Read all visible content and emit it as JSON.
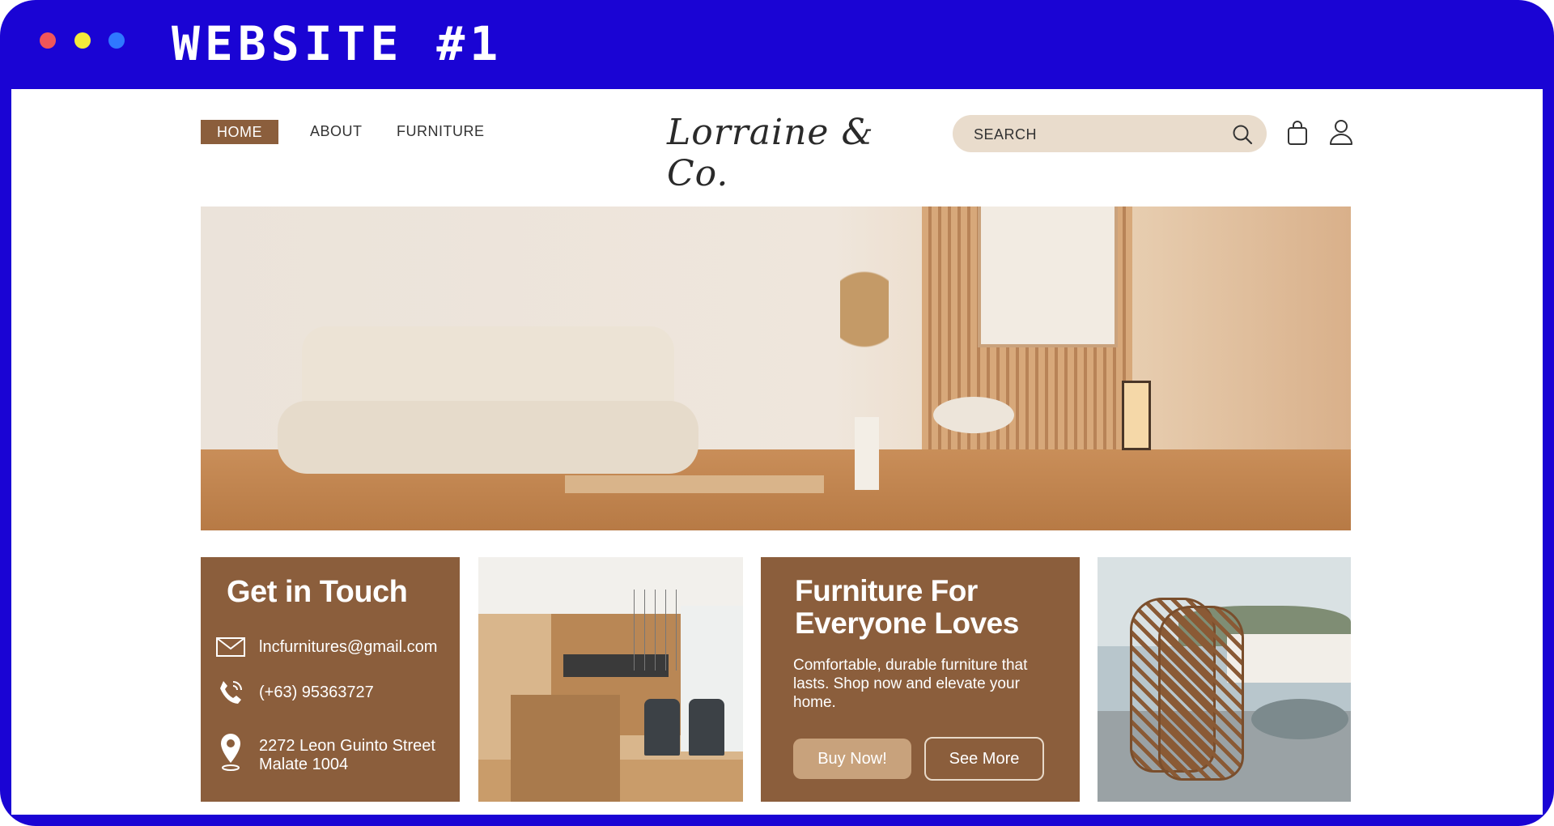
{
  "frame": {
    "title": "WEBSITE #1",
    "colors": {
      "frame": "#1a04d4",
      "dot_red": "#f0565a",
      "dot_yellow": "#f3ea3a",
      "dot_blue": "#2f78ff"
    }
  },
  "nav": {
    "items": [
      {
        "label": "HOME",
        "active": true
      },
      {
        "label": "ABOUT",
        "active": false
      },
      {
        "label": "FURNITURE",
        "active": false
      }
    ]
  },
  "logo": {
    "text": "Lorraine & Co."
  },
  "search": {
    "placeholder": "SEARCH",
    "icon": "search-icon"
  },
  "header_icons": {
    "cart": "shopping-bag-icon",
    "account": "user-icon"
  },
  "contact": {
    "title": "Get in Touch",
    "email": "lncfurnitures@gmail.com",
    "phone": "(+63) 95363727",
    "address_line1": "2272 Leon Guinto Street",
    "address_line2": "Malate 1004"
  },
  "promo": {
    "title": "Furniture For Everyone Loves",
    "description": "Comfortable, durable furniture that lasts. Shop now and elevate your home.",
    "buy_label": "Buy Now!",
    "more_label": "See More"
  },
  "colors": {
    "brand_brown": "#8b5e3c",
    "search_bg": "#e9dccc",
    "button_tan": "#c8a27c"
  }
}
